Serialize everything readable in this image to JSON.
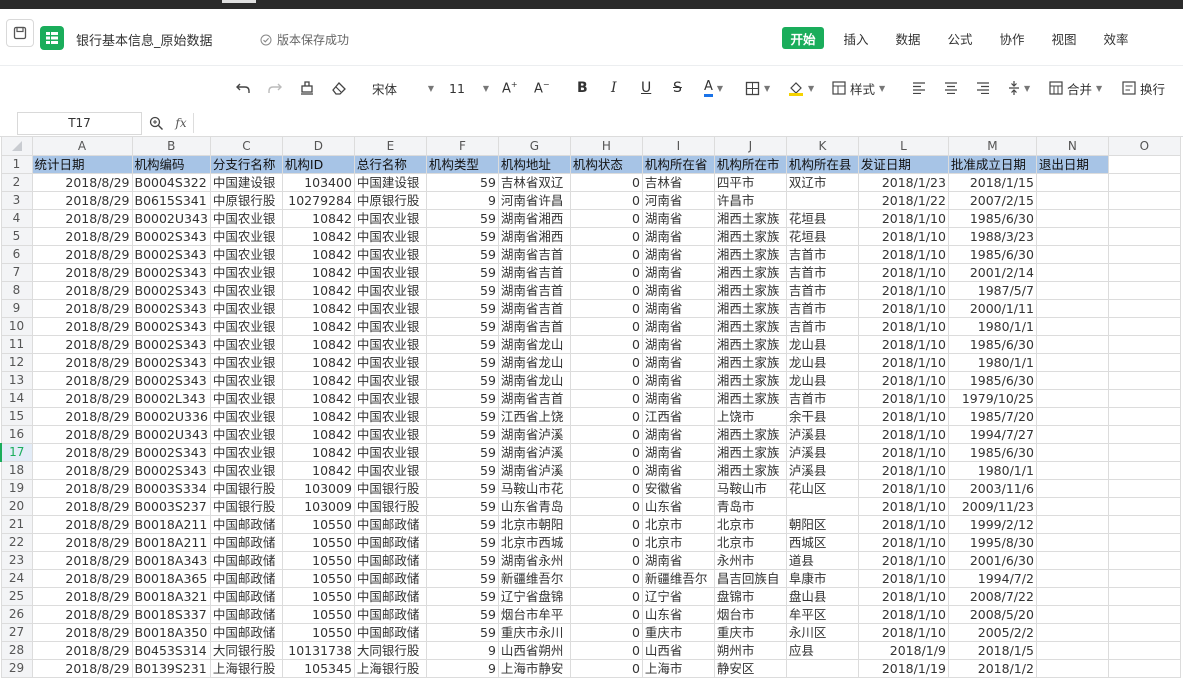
{
  "document": {
    "title": "银行基本信息_原始数据",
    "save_status": "版本保存成功"
  },
  "menu": [
    {
      "label": "开始",
      "active": true
    },
    {
      "label": "插入",
      "active": false
    },
    {
      "label": "数据",
      "active": false
    },
    {
      "label": "公式",
      "active": false
    },
    {
      "label": "协作",
      "active": false
    },
    {
      "label": "视图",
      "active": false
    },
    {
      "label": "效率",
      "active": false
    }
  ],
  "toolbar": {
    "font_name": "宋体",
    "font_size": "11",
    "style_label": "样式",
    "merge_label": "合并",
    "wrap_label": "换行",
    "font_color": "#1a73e8",
    "fill_color": "#f5d300"
  },
  "formula_bar": {
    "cell_ref": "T17",
    "content": ""
  },
  "sheet": {
    "columns": [
      "A",
      "B",
      "C",
      "D",
      "E",
      "F",
      "G",
      "H",
      "I",
      "J",
      "K",
      "L",
      "M",
      "N",
      "O"
    ],
    "rows": [
      [
        "统计日期",
        "机构编码",
        "分支行名称",
        "机构ID",
        "总行名称",
        "机构类型",
        "机构地址",
        "机构状态",
        "机构所在省",
        "机构所在市",
        "机构所在县",
        "发证日期",
        "批准成立日期",
        "退出日期",
        ""
      ],
      [
        "2018/8/29",
        "B0004S322",
        "中国建设银",
        "103400",
        "中国建设银",
        "59",
        "吉林省双辽",
        "0",
        "吉林省",
        "四平市",
        "双辽市",
        "2018/1/23",
        "2018/1/15",
        "",
        ""
      ],
      [
        "2018/8/29",
        "B0615S341",
        "中原银行股",
        "10279284",
        "中原银行股",
        "9",
        "河南省许昌",
        "0",
        "河南省",
        "许昌市",
        "",
        "2018/1/22",
        "2007/2/15",
        "",
        ""
      ],
      [
        "2018/8/29",
        "B0002U343",
        "中国农业银",
        "10842",
        "中国农业银",
        "59",
        "湖南省湘西",
        "0",
        "湖南省",
        "湘西土家族",
        "花垣县",
        "2018/1/10",
        "1985/6/30",
        "",
        ""
      ],
      [
        "2018/8/29",
        "B0002S343",
        "中国农业银",
        "10842",
        "中国农业银",
        "59",
        "湖南省湘西",
        "0",
        "湖南省",
        "湘西土家族",
        "花垣县",
        "2018/1/10",
        "1988/3/23",
        "",
        ""
      ],
      [
        "2018/8/29",
        "B0002S343",
        "中国农业银",
        "10842",
        "中国农业银",
        "59",
        "湖南省吉首",
        "0",
        "湖南省",
        "湘西土家族",
        "吉首市",
        "2018/1/10",
        "1985/6/30",
        "",
        ""
      ],
      [
        "2018/8/29",
        "B0002S343",
        "中国农业银",
        "10842",
        "中国农业银",
        "59",
        "湖南省吉首",
        "0",
        "湖南省",
        "湘西土家族",
        "吉首市",
        "2018/1/10",
        "2001/2/14",
        "",
        ""
      ],
      [
        "2018/8/29",
        "B0002S343",
        "中国农业银",
        "10842",
        "中国农业银",
        "59",
        "湖南省吉首",
        "0",
        "湖南省",
        "湘西土家族",
        "吉首市",
        "2018/1/10",
        "1987/5/7",
        "",
        ""
      ],
      [
        "2018/8/29",
        "B0002S343",
        "中国农业银",
        "10842",
        "中国农业银",
        "59",
        "湖南省吉首",
        "0",
        "湖南省",
        "湘西土家族",
        "吉首市",
        "2018/1/10",
        "2000/1/11",
        "",
        ""
      ],
      [
        "2018/8/29",
        "B0002S343",
        "中国农业银",
        "10842",
        "中国农业银",
        "59",
        "湖南省吉首",
        "0",
        "湖南省",
        "湘西土家族",
        "吉首市",
        "2018/1/10",
        "1980/1/1",
        "",
        ""
      ],
      [
        "2018/8/29",
        "B0002S343",
        "中国农业银",
        "10842",
        "中国农业银",
        "59",
        "湖南省龙山",
        "0",
        "湖南省",
        "湘西土家族",
        "龙山县",
        "2018/1/10",
        "1985/6/30",
        "",
        ""
      ],
      [
        "2018/8/29",
        "B0002S343",
        "中国农业银",
        "10842",
        "中国农业银",
        "59",
        "湖南省龙山",
        "0",
        "湖南省",
        "湘西土家族",
        "龙山县",
        "2018/1/10",
        "1980/1/1",
        "",
        ""
      ],
      [
        "2018/8/29",
        "B0002S343",
        "中国农业银",
        "10842",
        "中国农业银",
        "59",
        "湖南省龙山",
        "0",
        "湖南省",
        "湘西土家族",
        "龙山县",
        "2018/1/10",
        "1985/6/30",
        "",
        ""
      ],
      [
        "2018/8/29",
        "B0002L343",
        "中国农业银",
        "10842",
        "中国农业银",
        "59",
        "湖南省吉首",
        "0",
        "湖南省",
        "湘西土家族",
        "吉首市",
        "2018/1/10",
        "1979/10/25",
        "",
        ""
      ],
      [
        "2018/8/29",
        "B0002U336",
        "中国农业银",
        "10842",
        "中国农业银",
        "59",
        "江西省上饶",
        "0",
        "江西省",
        "上饶市",
        "余干县",
        "2018/1/10",
        "1985/7/20",
        "",
        ""
      ],
      [
        "2018/8/29",
        "B0002U343",
        "中国农业银",
        "10842",
        "中国农业银",
        "59",
        "湖南省泸溪",
        "0",
        "湖南省",
        "湘西土家族",
        "泸溪县",
        "2018/1/10",
        "1994/7/27",
        "",
        ""
      ],
      [
        "2018/8/29",
        "B0002S343",
        "中国农业银",
        "10842",
        "中国农业银",
        "59",
        "湖南省泸溪",
        "0",
        "湖南省",
        "湘西土家族",
        "泸溪县",
        "2018/1/10",
        "1985/6/30",
        "",
        ""
      ],
      [
        "2018/8/29",
        "B0002S343",
        "中国农业银",
        "10842",
        "中国农业银",
        "59",
        "湖南省泸溪",
        "0",
        "湖南省",
        "湘西土家族",
        "泸溪县",
        "2018/1/10",
        "1980/1/1",
        "",
        ""
      ],
      [
        "2018/8/29",
        "B0003S334",
        "中国银行股",
        "103009",
        "中国银行股",
        "59",
        "马鞍山市花",
        "0",
        "安徽省",
        "马鞍山市",
        "花山区",
        "2018/1/10",
        "2003/11/6",
        "",
        ""
      ],
      [
        "2018/8/29",
        "B0003S237",
        "中国银行股",
        "103009",
        "中国银行股",
        "59",
        "山东省青岛",
        "0",
        "山东省",
        "青岛市",
        "",
        "2018/1/10",
        "2009/11/23",
        "",
        ""
      ],
      [
        "2018/8/29",
        "B0018A211",
        "中国邮政储",
        "10550",
        "中国邮政储",
        "59",
        "北京市朝阳",
        "0",
        "北京市",
        "北京市",
        "朝阳区",
        "2018/1/10",
        "1999/2/12",
        "",
        ""
      ],
      [
        "2018/8/29",
        "B0018A211",
        "中国邮政储",
        "10550",
        "中国邮政储",
        "59",
        "北京市西城",
        "0",
        "北京市",
        "北京市",
        "西城区",
        "2018/1/10",
        "1995/8/30",
        "",
        ""
      ],
      [
        "2018/8/29",
        "B0018A343",
        "中国邮政储",
        "10550",
        "中国邮政储",
        "59",
        "湖南省永州",
        "0",
        "湖南省",
        "永州市",
        "道县",
        "2018/1/10",
        "2001/6/30",
        "",
        ""
      ],
      [
        "2018/8/29",
        "B0018A365",
        "中国邮政储",
        "10550",
        "中国邮政储",
        "59",
        "新疆维吾尔",
        "0",
        "新疆维吾尔",
        "昌吉回族自",
        "阜康市",
        "2018/1/10",
        "1994/7/2",
        "",
        ""
      ],
      [
        "2018/8/29",
        "B0018A321",
        "中国邮政储",
        "10550",
        "中国邮政储",
        "59",
        "辽宁省盘锦",
        "0",
        "辽宁省",
        "盘锦市",
        "盘山县",
        "2018/1/10",
        "2008/7/22",
        "",
        ""
      ],
      [
        "2018/8/29",
        "B0018S337",
        "中国邮政储",
        "10550",
        "中国邮政储",
        "59",
        "烟台市牟平",
        "0",
        "山东省",
        "烟台市",
        "牟平区",
        "2018/1/10",
        "2008/5/20",
        "",
        ""
      ],
      [
        "2018/8/29",
        "B0018A350",
        "中国邮政储",
        "10550",
        "中国邮政储",
        "59",
        "重庆市永川",
        "0",
        "重庆市",
        "重庆市",
        "永川区",
        "2018/1/10",
        "2005/2/2",
        "",
        ""
      ],
      [
        "2018/8/29",
        "B0453S314",
        "大同银行股",
        "10131738",
        "大同银行股",
        "9",
        "山西省朔州",
        "0",
        "山西省",
        "朔州市",
        "应县",
        "2018/1/9",
        "2018/1/5",
        "",
        ""
      ],
      [
        "2018/8/29",
        "B0139S231",
        "上海银行股",
        "105345",
        "上海银行股",
        "9",
        "上海市静安",
        "0",
        "上海市",
        "静安区",
        "",
        "2018/1/19",
        "2018/1/2",
        "",
        ""
      ]
    ],
    "selected_row": 17
  }
}
